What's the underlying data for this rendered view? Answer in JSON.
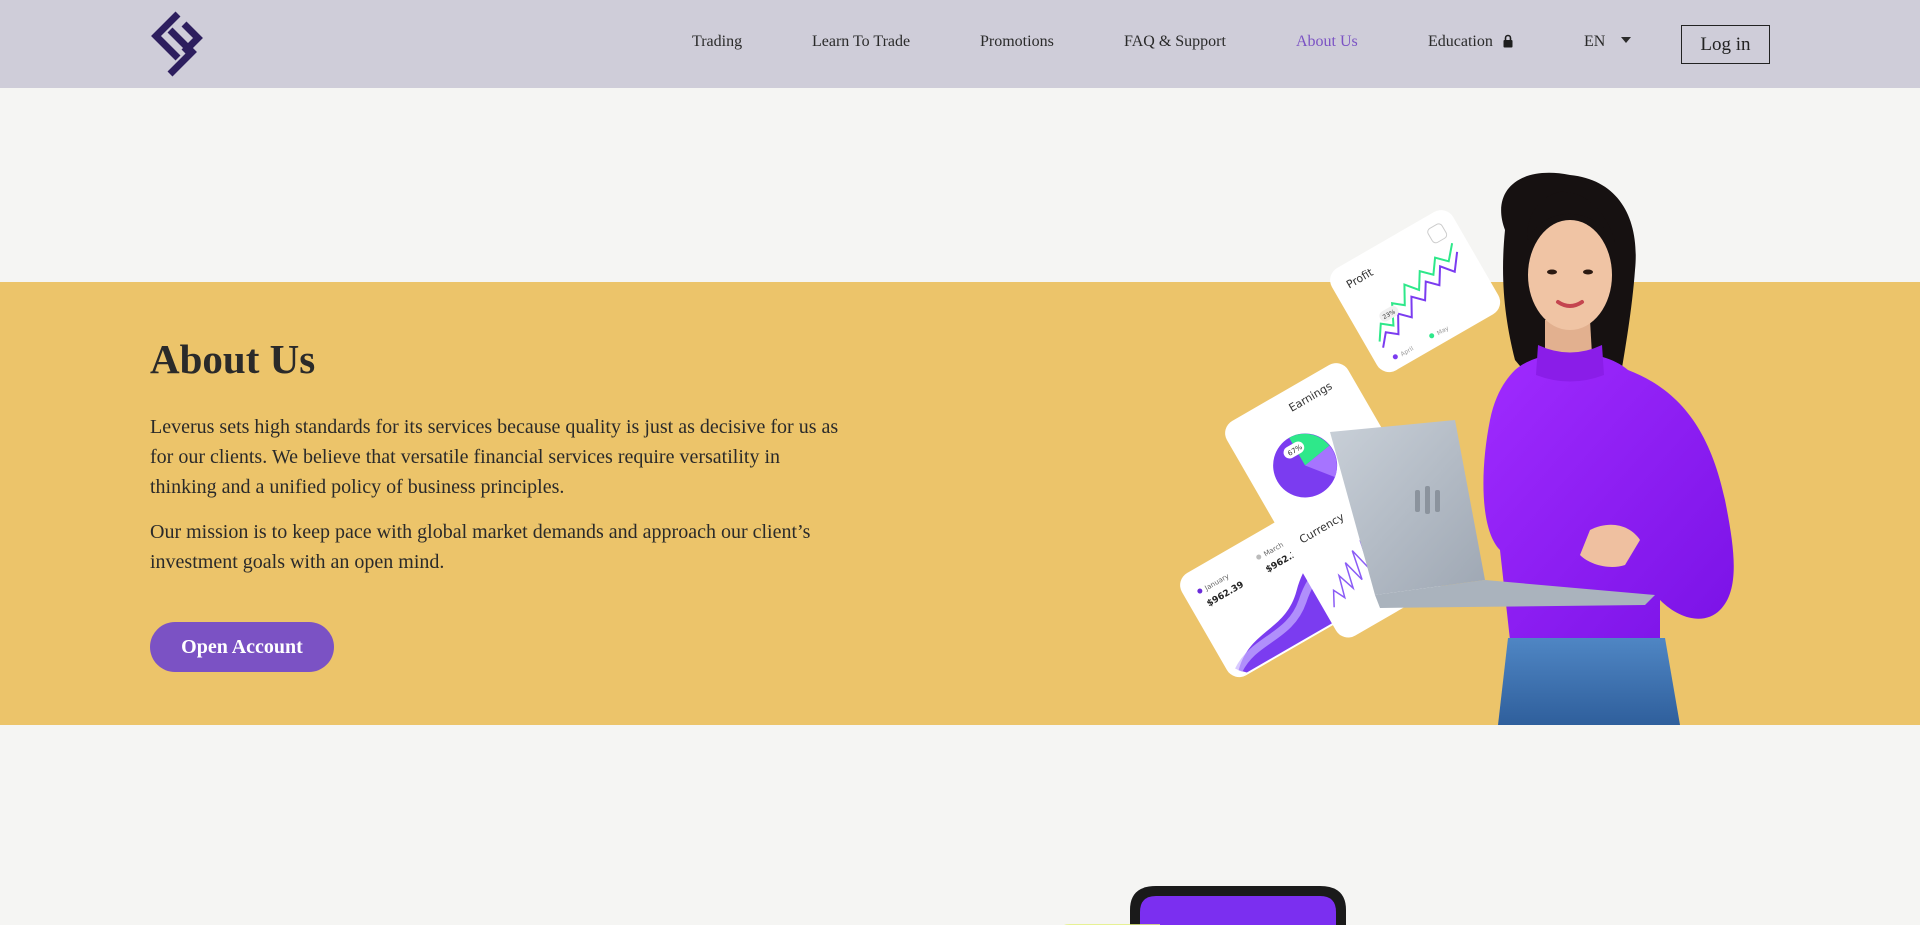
{
  "header": {
    "nav": [
      {
        "label": "Trading",
        "active": false
      },
      {
        "label": "Learn To Trade",
        "active": false
      },
      {
        "label": "Promotions",
        "active": false
      },
      {
        "label": "FAQ & Support",
        "active": false
      },
      {
        "label": "About Us",
        "active": true
      },
      {
        "label": "Education",
        "active": false
      }
    ],
    "language": "EN",
    "login_label": "Log in"
  },
  "hero": {
    "title": "About Us",
    "paragraph1": "Leverus sets high standards for its services because quality is just as decisive for us as for our clients. We believe that versatile financial services require versatility in thinking and a unified policy of business principles.",
    "paragraph2": "Our mission is to keep pace with global market demands and approach our client’s investment goals with an open mind.",
    "cta_label": "Open Account"
  },
  "illustration": {
    "card_profit": "Profit",
    "card_earnings": "Earnings",
    "card_currency": "Currency",
    "pct_profit": "23%",
    "pct_earnings": "67%",
    "price_left": "$962.39",
    "price_right": "$962.39",
    "month_left": "January",
    "month_right": "March",
    "legend_profit_1": "April",
    "legend_profit_2": "May"
  },
  "colors": {
    "header_bg": "#cfcdd9",
    "band_bg": "#ecc46a",
    "accent": "#7b52c4",
    "page_bg": "#f5f5f3"
  }
}
